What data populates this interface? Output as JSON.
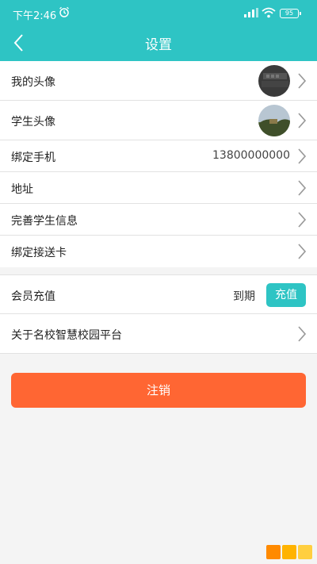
{
  "status_bar": {
    "time": "下午2:46",
    "battery": "95",
    "icons": [
      "alarm-icon",
      "signal-icon",
      "wifi-icon",
      "battery-icon"
    ]
  },
  "header": {
    "title": "设置",
    "back_icon": "chevron-left-icon"
  },
  "colors": {
    "accent": "#2ec4c4",
    "logout": "#ff6633",
    "background": "#f4f4f4"
  },
  "settings": {
    "my_avatar": "我的头像",
    "student_avatar": "学生头像",
    "bind_phone": "绑定手机",
    "phone_value": "13800000000",
    "address": "地址",
    "complete_student_info": "完善学生信息",
    "bind_card": "绑定接送卡"
  },
  "membership": {
    "label": "会员充值",
    "expire_label": "到期",
    "recharge_button": "充值"
  },
  "about": {
    "label": "关于名校智慧校园平台"
  },
  "logout": {
    "label": "注销"
  }
}
